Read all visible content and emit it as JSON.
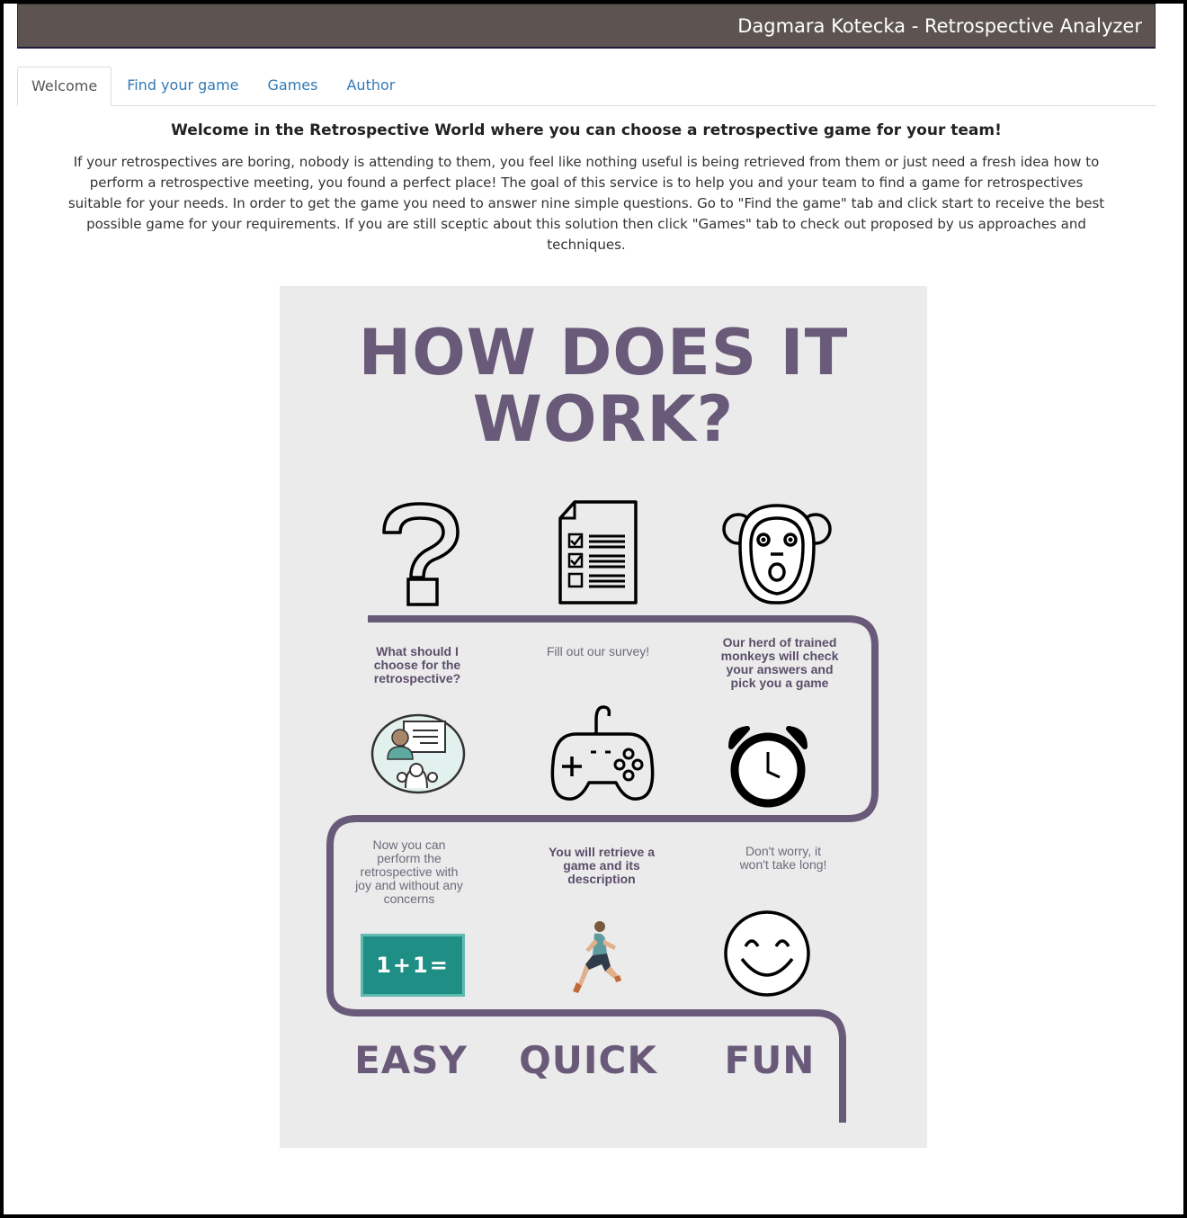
{
  "app": {
    "title": "Dagmara Kotecka - Retrospective Analyzer"
  },
  "tabs": [
    {
      "label": "Welcome",
      "active": true
    },
    {
      "label": "Find your game",
      "active": false
    },
    {
      "label": "Games",
      "active": false
    },
    {
      "label": "Author",
      "active": false
    }
  ],
  "welcome": {
    "heading": "Welcome in the Retrospective World where you can choose a retrospective game for your team!",
    "intro": "If your retrospectives are boring, nobody is attending to them, you feel like nothing useful is being retrieved from them or just need a fresh idea how to perform a retrospective meeting, you found a perfect place! The goal of this service is to help you and your team to find a game for retrospectives suitable for your needs. In order to get the game you need to answer nine simple questions. Go to \"Find the game\" tab and click start to receive the best possible game for your requirements. If you are still sceptic about this solution then click \"Games\" tab to check out proposed by us approaches and techniques."
  },
  "infographic": {
    "title_line1": "HOW DOES IT",
    "title_line2": "WORK?",
    "captions": {
      "question": "What should I choose for the retrospective?",
      "survey": "Fill out our survey!",
      "monkeys": "Our herd of trained monkeys will check your answers and pick you a game",
      "perform": "Now you can perform the retrospective with joy and without any concerns",
      "retrieve": "You will retrieve a game and its description",
      "worry": "Don't worry, it won't take long!"
    },
    "blackboard_text": "1+1=",
    "words": [
      "EASY",
      "QUICK",
      "FUN"
    ],
    "colors": {
      "accent": "#6a5a7a",
      "panel": "#ebebeb",
      "board": "#1f8f86"
    }
  }
}
